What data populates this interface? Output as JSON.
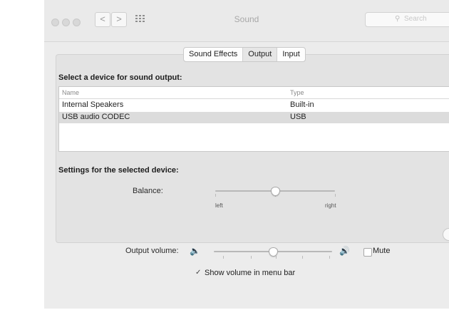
{
  "window": {
    "title": "Sound"
  },
  "toolbar": {
    "back_glyph": "<",
    "forward_glyph": ">",
    "show_all_icon": "grid-icon",
    "search": {
      "placeholder": "Search",
      "icon": "search-icon"
    }
  },
  "tabs": [
    {
      "label": "Sound Effects",
      "active": false
    },
    {
      "label": "Output",
      "active": true
    },
    {
      "label": "Input",
      "active": false
    }
  ],
  "device_section": {
    "heading": "Select a device for sound output:",
    "columns": [
      "Name",
      "Type"
    ],
    "rows": [
      {
        "name": "Internal Speakers",
        "type": "Built-in",
        "selected": false
      },
      {
        "name": "USB audio CODEC",
        "type": "USB",
        "selected": true
      }
    ]
  },
  "settings": {
    "heading": "Settings for the selected device:",
    "balance": {
      "label": "Balance:",
      "left_label": "left",
      "right_label": "right",
      "value": 0.5
    }
  },
  "output": {
    "volume_label": "Output volume:",
    "volume_value": 0.5,
    "mute_label": "Mute",
    "mute_checked": false,
    "show_in_menu_bar_label": "Show volume in menu bar",
    "show_in_menu_bar_checked": true
  },
  "colors": {
    "window_bg": "#ececec",
    "panel_bg": "#e3e3e3",
    "selected_row": "#dcdcdc"
  }
}
